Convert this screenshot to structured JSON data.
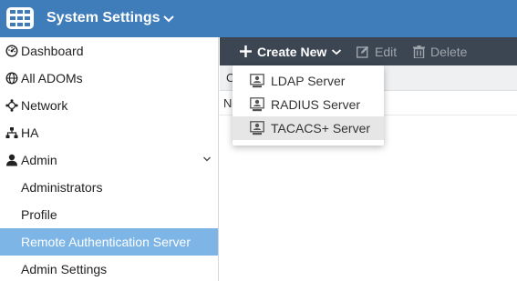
{
  "header": {
    "title": "System Settings"
  },
  "sidebar": {
    "items": [
      {
        "label": "Dashboard",
        "icon": "dashboard-icon"
      },
      {
        "label": "All ADOMs",
        "icon": "globe-icon"
      },
      {
        "label": "Network",
        "icon": "network-icon"
      },
      {
        "label": "HA",
        "icon": "ha-icon"
      },
      {
        "label": "Admin",
        "icon": "user-icon",
        "expanded": true
      },
      {
        "label": "Administrators"
      },
      {
        "label": "Profile"
      },
      {
        "label": "Remote Authentication Server",
        "active": true
      },
      {
        "label": "Admin Settings"
      }
    ]
  },
  "toolbar": {
    "create_label": "Create New",
    "edit_label": "Edit",
    "delete_label": "Delete"
  },
  "table": {
    "header_visible": "C",
    "row_visible": "N"
  },
  "dropdown": {
    "items": [
      {
        "label": "LDAP Server"
      },
      {
        "label": "RADIUS Server"
      },
      {
        "label": "TACACS+ Server",
        "highlighted": true
      }
    ]
  },
  "colors": {
    "header_bg": "#3f7dba",
    "toolbar_bg": "#3b4652",
    "active_item_bg": "#7cb5e6"
  }
}
